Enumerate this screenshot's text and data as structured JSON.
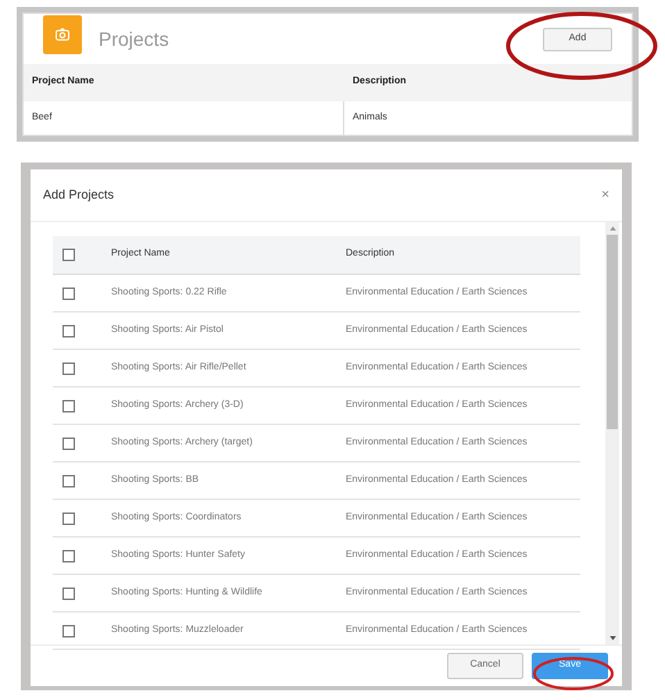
{
  "projects_panel": {
    "title": "Projects",
    "add_button": "Add",
    "columns": [
      "Project Name",
      "Description"
    ],
    "rows": [
      {
        "name": "Beef",
        "description": "Animals"
      }
    ]
  },
  "dialog": {
    "title": "Add Projects",
    "close": "×",
    "header_checked": false,
    "columns": [
      "Project Name",
      "Description"
    ],
    "rows": [
      {
        "name": "Shooting Sports: 0.22 Rifle",
        "description": "Environmental Education / Earth Sciences",
        "checked": false
      },
      {
        "name": "Shooting Sports: Air Pistol",
        "description": "Environmental Education / Earth Sciences",
        "checked": false
      },
      {
        "name": "Shooting Sports: Air Rifle/Pellet",
        "description": "Environmental Education / Earth Sciences",
        "checked": false
      },
      {
        "name": "Shooting Sports: Archery (3-D)",
        "description": "Environmental Education / Earth Sciences",
        "checked": false
      },
      {
        "name": "Shooting Sports: Archery (target)",
        "description": "Environmental Education / Earth Sciences",
        "checked": false
      },
      {
        "name": "Shooting Sports: BB",
        "description": "Environmental Education / Earth Sciences",
        "checked": false
      },
      {
        "name": "Shooting Sports: Coordinators",
        "description": "Environmental Education / Earth Sciences",
        "checked": false
      },
      {
        "name": "Shooting Sports: Hunter Safety",
        "description": "Environmental Education / Earth Sciences",
        "checked": false
      },
      {
        "name": "Shooting Sports: Hunting & Wildlife",
        "description": "Environmental Education / Earth Sciences",
        "checked": false
      },
      {
        "name": "Shooting Sports: Muzzleloader",
        "description": "Environmental Education / Earth Sciences",
        "checked": false
      }
    ],
    "cancel_button": "Cancel",
    "save_button": "Save"
  }
}
